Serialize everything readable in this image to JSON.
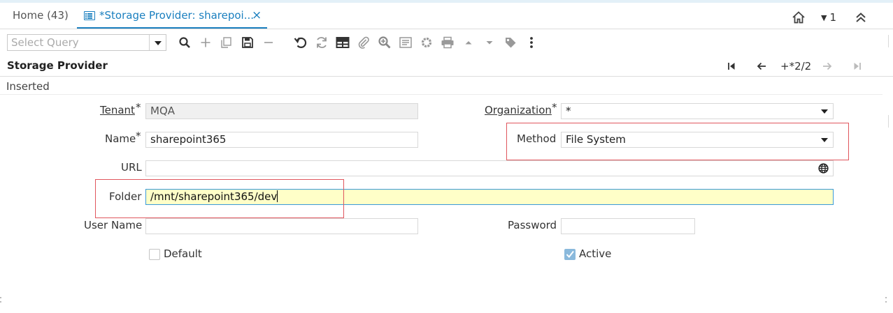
{
  "tabs": {
    "home_label": "Home (43)",
    "active_label": "*Storage Provider: sharepoi...",
    "close_glyph": "×",
    "count_label": "1"
  },
  "toolbar": {
    "query_placeholder": "Select Query",
    "icons": [
      "search-icon",
      "new-record-icon",
      "copy-icon",
      "save-icon",
      "delete-icon",
      "undo-icon",
      "refresh-icon",
      "grid-toggle-icon",
      "attachment-icon",
      "zoom-icon",
      "report-icon",
      "process-icon",
      "print-icon",
      "nav-up-icon",
      "nav-down-icon",
      "tag-icon",
      "more-icon"
    ]
  },
  "window": {
    "title": "Storage Provider",
    "record_count": "+*2/2",
    "status": "Inserted"
  },
  "form": {
    "tenant": {
      "label": "Tenant",
      "value": "MQA",
      "required": "*"
    },
    "organization": {
      "label": "Organization",
      "value": "*",
      "required": "*"
    },
    "name": {
      "label": "Name",
      "value": "sharepoint365",
      "required": "*"
    },
    "method": {
      "label": "Method",
      "value": "File System"
    },
    "url": {
      "label": "URL",
      "value": ""
    },
    "folder": {
      "label": "Folder",
      "value": "/mnt/sharepoint365/dev"
    },
    "user_name": {
      "label": "User Name",
      "value": ""
    },
    "password": {
      "label": "Password",
      "value": ""
    },
    "default": {
      "label": "Default",
      "checked": false
    },
    "active": {
      "label": "Active",
      "checked": true
    }
  },
  "colors": {
    "accent": "#1a7fbf",
    "highlight_field": "#ffffc8",
    "annotation_box": "#e0565d"
  }
}
